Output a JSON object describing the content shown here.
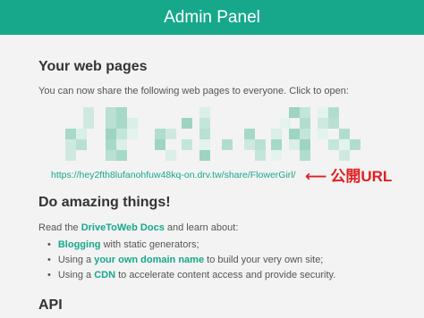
{
  "header": {
    "title": "Admin Panel"
  },
  "web_pages": {
    "heading": "Your web pages",
    "intro": "You can now share the following web pages to everyone. Click to open:",
    "url": "https://hey2fth8lufanohfuw48kq-on.drv.tw/share/FlowerGirl/",
    "annotation": "公開URL",
    "annotation_arrow": "⟵"
  },
  "amazing": {
    "heading": "Do amazing things!",
    "read_prefix": "Read the ",
    "docs_link": "DriveToWeb Docs",
    "read_suffix": " and learn about:",
    "items": [
      {
        "prefix": "",
        "link": "Blogging",
        "suffix": " with static generators;"
      },
      {
        "prefix": "Using a ",
        "link": "your own domain name",
        "suffix": " to build your very own site;"
      },
      {
        "prefix": "Using a ",
        "link": "CDN",
        "suffix": " to accelerate content access and provide security."
      }
    ]
  },
  "api": {
    "heading": "API"
  },
  "colors": {
    "accent": "#17a88b",
    "annotation": "#e02020"
  }
}
